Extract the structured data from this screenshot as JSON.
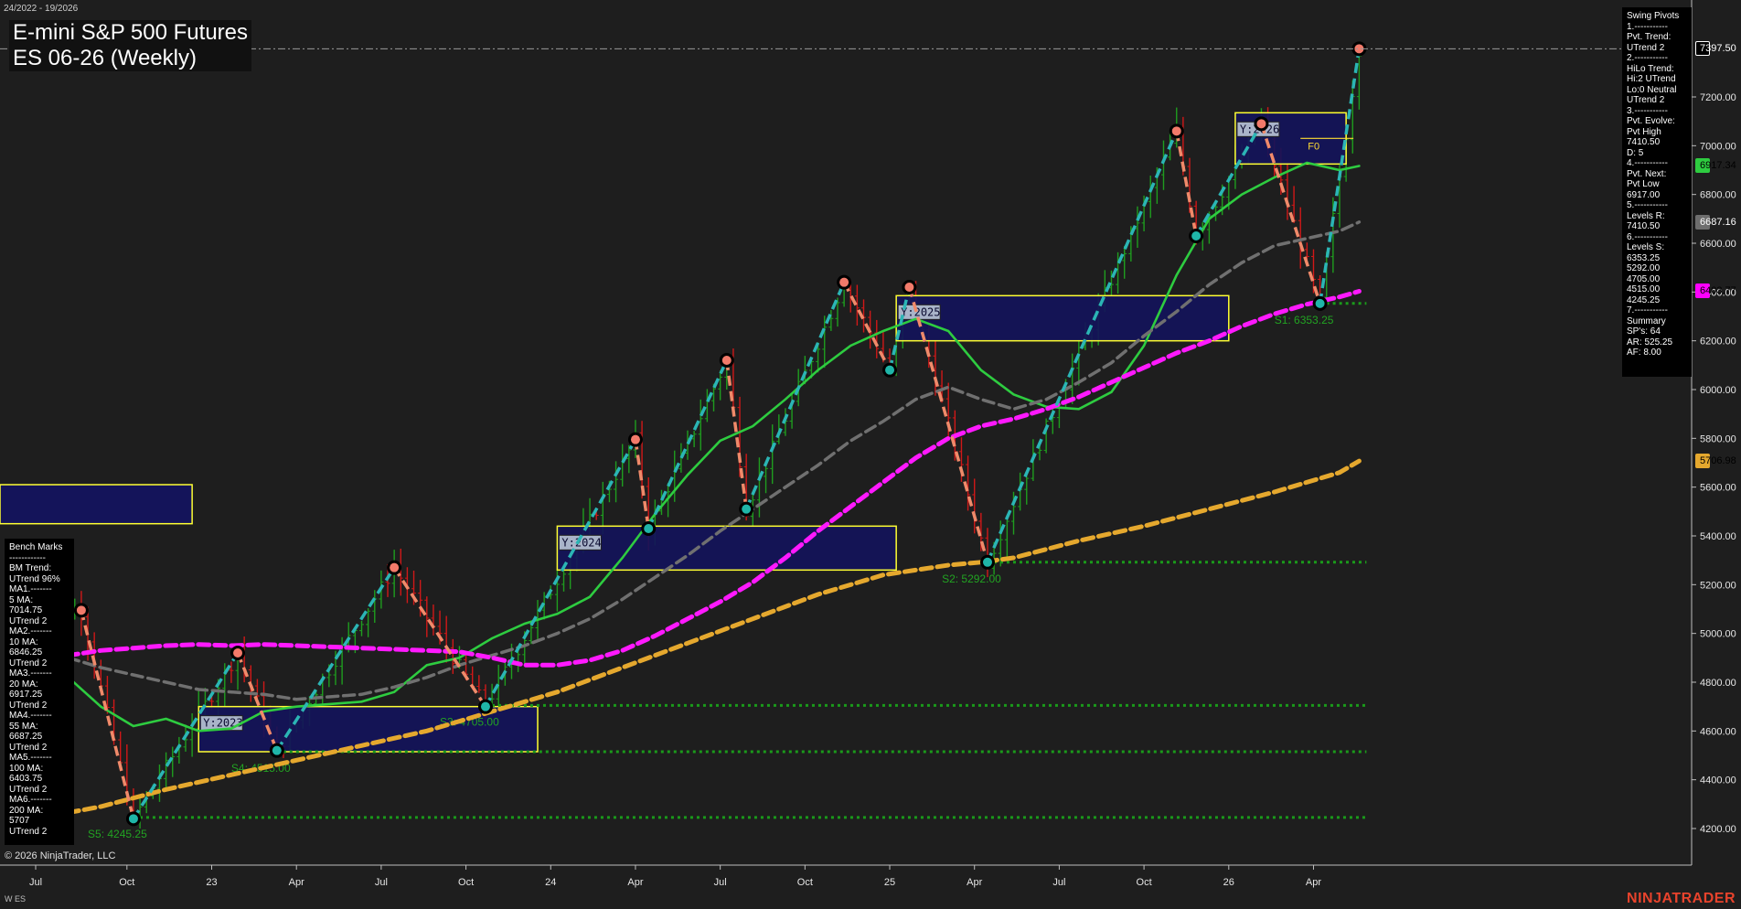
{
  "header": {
    "date_range": "24/2022 - 19/2026",
    "title_line1": "E-mini S&P 500 Futures",
    "title_line2": "ES 06-26 (Weekly)"
  },
  "footer": {
    "copyright": "© 2026 NinjaTrader, LLC",
    "series_tag": "W ES",
    "brand": "NINJATRADER"
  },
  "bench_marks": {
    "lines": [
      "Bench Marks",
      "------------",
      "BM Trend:",
      "UTrend 96%",
      "MA1.-------",
      "5 MA:",
      "7014.75",
      "UTrend 2",
      "MA2.-------",
      "10 MA:",
      "6846.25",
      "UTrend 2",
      "MA3.-------",
      "20 MA:",
      "6917.25",
      "UTrend 2",
      "MA4.-------",
      "55 MA:",
      "6687.25",
      "UTrend 2",
      "MA5.-------",
      "100 MA:",
      "6403.75",
      "UTrend 2",
      "MA6.-------",
      "200 MA:",
      "5707",
      "UTrend 2"
    ]
  },
  "swing_pivots": {
    "lines": [
      "Swing Pivots",
      "1.-----------",
      "Pvt. Trend:",
      "UTrend 2",
      "2.-----------",
      "HiLo Trend:",
      "Hi:2 UTrend",
      "Lo:0 Neutral",
      "UTrend 2",
      "3.-----------",
      "Pvt. Evolve:",
      "Pvt High",
      "7410.50",
      "D: 5",
      "4.-----------",
      "Pvt. Next:",
      "Pvt Low",
      "6917.00",
      "5.-----------",
      "Levels R:",
      "7410.50",
      "6.-----------",
      "Levels S:",
      "6353.25",
      "5292.00",
      "4705.00",
      "4515.00",
      "4245.25",
      "7.-----------",
      "Summary",
      "SP's: 64",
      "AR: 525.25",
      "AF: 8.00"
    ]
  },
  "price_tags": [
    {
      "label": "7397.50",
      "price": 7397.5,
      "bg": "#000000",
      "fg": "#ffffff",
      "border": "#ffffff"
    },
    {
      "label": "6917.34",
      "price": 6917.34,
      "bg": "#2ecc40",
      "fg": "#000000",
      "border": "#2ecc40"
    },
    {
      "label": "6687.16",
      "price": 6687.16,
      "bg": "#6e6e6e",
      "fg": "#ffffff",
      "border": "#6e6e6e"
    },
    {
      "label": "6403.77",
      "price": 6403.77,
      "bg": "#ff00ff",
      "fg": "#000000",
      "border": "#ff00ff"
    },
    {
      "label": "5706.98",
      "price": 5706.98,
      "bg": "#e5a82e",
      "fg": "#000000",
      "border": "#e5a82e"
    }
  ],
  "colors": {
    "background": "#1e1e1e",
    "ma_green": "#2ecc40",
    "ma_gray": "#707070",
    "ma_magenta": "#ff19ff",
    "ma_orange": "#e5a82e",
    "swing_up": "#2bb5b5",
    "swing_down": "#f08a6a",
    "box_fill": "#14145a",
    "box_border": "#ffff33",
    "support": "#1a9a1a",
    "bar_up": "#1f9d1f",
    "bar_down": "#d01818"
  },
  "chart_data": {
    "type": "line",
    "title": "E-mini S&P 500 Futures",
    "subtitle": "ES 06-26 (Weekly)",
    "xlabel": "",
    "ylabel": "",
    "ylim": [
      4100,
      7500
    ],
    "x_tick_labels": [
      "Jul",
      "Oct",
      "23",
      "Apr",
      "Jul",
      "Oct",
      "24",
      "Apr",
      "Jul",
      "Oct",
      "25",
      "Apr",
      "Jul",
      "Oct",
      "26",
      "Apr"
    ],
    "x_tick_weeks": [
      0,
      14,
      27,
      40,
      53,
      66,
      79,
      92,
      105,
      118,
      131,
      144,
      157,
      170,
      183,
      196
    ],
    "y_ticks": [
      4200,
      4400,
      4600,
      4800,
      5000,
      5200,
      5400,
      5600,
      5800,
      6000,
      6200,
      6400,
      6600,
      6800,
      7000,
      7200
    ],
    "grid": false,
    "legend": "none",
    "swing_pivots": [
      {
        "week": 7,
        "price": 5095,
        "kind": "high"
      },
      {
        "week": 15,
        "price": 4240,
        "kind": "low"
      },
      {
        "week": 31,
        "price": 4920,
        "kind": "high"
      },
      {
        "week": 37,
        "price": 4520,
        "kind": "low"
      },
      {
        "week": 55,
        "price": 5270,
        "kind": "high"
      },
      {
        "week": 69,
        "price": 4700,
        "kind": "low"
      },
      {
        "week": 92,
        "price": 5795,
        "kind": "high"
      },
      {
        "week": 94,
        "price": 5430,
        "kind": "low"
      },
      {
        "week": 106,
        "price": 6120,
        "kind": "high"
      },
      {
        "week": 109,
        "price": 5510,
        "kind": "low"
      },
      {
        "week": 124,
        "price": 6440,
        "kind": "high"
      },
      {
        "week": 131,
        "price": 6080,
        "kind": "low"
      },
      {
        "week": 134,
        "price": 6420,
        "kind": "high"
      },
      {
        "week": 146,
        "price": 5292,
        "kind": "low"
      },
      {
        "week": 175,
        "price": 7060,
        "kind": "high"
      },
      {
        "week": 178,
        "price": 6630,
        "kind": "low"
      },
      {
        "week": 188,
        "price": 7090,
        "kind": "high"
      },
      {
        "week": 197,
        "price": 6353,
        "kind": "low"
      },
      {
        "week": 203,
        "price": 7397.5,
        "kind": "high"
      }
    ],
    "year_boxes": [
      {
        "label": "Y:2023",
        "week_start": 25,
        "week_end": 77,
        "price_low": 4515,
        "price_high": 4700
      },
      {
        "label": "Y:2024",
        "week_start": 80,
        "week_end": 132,
        "price_low": 5260,
        "price_high": 5440
      },
      {
        "label": "Y:2025",
        "week_start": 132,
        "week_end": 183,
        "price_low": 6200,
        "price_high": 6385
      },
      {
        "label": "Y:2026",
        "week_start": 184,
        "week_end": 201,
        "price_low": 6925,
        "price_high": 7135
      }
    ],
    "prior_box": {
      "week_start": -8,
      "week_end": 24,
      "price_low": 5450,
      "price_high": 5610
    },
    "support_levels": [
      {
        "label": "S1: 6353.25",
        "price": 6353.25,
        "week_start": 197,
        "label_week": 190
      },
      {
        "label": "S2: 5292.00",
        "price": 5292,
        "week_start": 146,
        "label_week": 139
      },
      {
        "label": "S3: 4705.00",
        "price": 4705,
        "week_start": 69,
        "label_week": 62
      },
      {
        "label": "S4: 4515.00",
        "price": 4515,
        "week_start": 37,
        "label_week": 30
      },
      {
        "label": "S5: 4245.25",
        "price": 4245.25,
        "week_start": 15,
        "label_week": 8
      }
    ],
    "f0_label": "F0",
    "f0_price": 7030,
    "moving_averages": [
      {
        "id": "ma_20",
        "color_key": "ma_green",
        "dashed": false,
        "points": [
          [
            0,
            4880
          ],
          [
            5,
            4820
          ],
          [
            10,
            4700
          ],
          [
            15,
            4620
          ],
          [
            20,
            4650
          ],
          [
            25,
            4600
          ],
          [
            30,
            4610
          ],
          [
            35,
            4680
          ],
          [
            40,
            4700
          ],
          [
            50,
            4720
          ],
          [
            55,
            4760
          ],
          [
            60,
            4870
          ],
          [
            65,
            4900
          ],
          [
            70,
            4980
          ],
          [
            75,
            5040
          ],
          [
            80,
            5080
          ],
          [
            85,
            5150
          ],
          [
            90,
            5310
          ],
          [
            95,
            5490
          ],
          [
            100,
            5650
          ],
          [
            105,
            5790
          ],
          [
            110,
            5850
          ],
          [
            115,
            5960
          ],
          [
            120,
            6080
          ],
          [
            125,
            6180
          ],
          [
            130,
            6240
          ],
          [
            135,
            6290
          ],
          [
            140,
            6240
          ],
          [
            145,
            6080
          ],
          [
            150,
            5980
          ],
          [
            155,
            5930
          ],
          [
            160,
            5920
          ],
          [
            165,
            5990
          ],
          [
            170,
            6180
          ],
          [
            175,
            6470
          ],
          [
            180,
            6700
          ],
          [
            185,
            6800
          ],
          [
            190,
            6870
          ],
          [
            195,
            6930
          ],
          [
            200,
            6900
          ],
          [
            203,
            6917
          ]
        ]
      },
      {
        "id": "ma_55",
        "color_key": "ma_gray",
        "dashed": true,
        "points": [
          [
            0,
            4920
          ],
          [
            5,
            4900
          ],
          [
            10,
            4860
          ],
          [
            15,
            4830
          ],
          [
            20,
            4800
          ],
          [
            25,
            4770
          ],
          [
            30,
            4760
          ],
          [
            35,
            4750
          ],
          [
            40,
            4730
          ],
          [
            45,
            4740
          ],
          [
            50,
            4750
          ],
          [
            55,
            4780
          ],
          [
            60,
            4820
          ],
          [
            65,
            4870
          ],
          [
            70,
            4910
          ],
          [
            75,
            4950
          ],
          [
            80,
            5000
          ],
          [
            85,
            5060
          ],
          [
            90,
            5140
          ],
          [
            95,
            5230
          ],
          [
            100,
            5320
          ],
          [
            105,
            5420
          ],
          [
            110,
            5510
          ],
          [
            115,
            5600
          ],
          [
            120,
            5690
          ],
          [
            125,
            5790
          ],
          [
            130,
            5870
          ],
          [
            135,
            5960
          ],
          [
            140,
            6010
          ],
          [
            145,
            5960
          ],
          [
            150,
            5920
          ],
          [
            155,
            5960
          ],
          [
            160,
            6030
          ],
          [
            165,
            6110
          ],
          [
            170,
            6220
          ],
          [
            175,
            6320
          ],
          [
            180,
            6430
          ],
          [
            185,
            6520
          ],
          [
            190,
            6590
          ],
          [
            195,
            6620
          ],
          [
            200,
            6650
          ],
          [
            203,
            6687
          ]
        ]
      },
      {
        "id": "ma_100",
        "color_key": "ma_magenta",
        "dashed": true,
        "points": [
          [
            0,
            4870
          ],
          [
            5,
            4910
          ],
          [
            10,
            4930
          ],
          [
            15,
            4940
          ],
          [
            20,
            4950
          ],
          [
            25,
            4955
          ],
          [
            30,
            4950
          ],
          [
            35,
            4955
          ],
          [
            40,
            4950
          ],
          [
            45,
            4945
          ],
          [
            50,
            4940
          ],
          [
            55,
            4935
          ],
          [
            60,
            4930
          ],
          [
            65,
            4925
          ],
          [
            70,
            4900
          ],
          [
            75,
            4870
          ],
          [
            80,
            4870
          ],
          [
            85,
            4890
          ],
          [
            90,
            4930
          ],
          [
            95,
            4990
          ],
          [
            100,
            5060
          ],
          [
            105,
            5130
          ],
          [
            110,
            5210
          ],
          [
            115,
            5310
          ],
          [
            120,
            5420
          ],
          [
            125,
            5520
          ],
          [
            130,
            5620
          ],
          [
            135,
            5720
          ],
          [
            140,
            5800
          ],
          [
            145,
            5850
          ],
          [
            150,
            5880
          ],
          [
            155,
            5920
          ],
          [
            160,
            5970
          ],
          [
            165,
            6030
          ],
          [
            170,
            6090
          ],
          [
            175,
            6150
          ],
          [
            180,
            6200
          ],
          [
            185,
            6260
          ],
          [
            190,
            6310
          ],
          [
            195,
            6350
          ],
          [
            200,
            6380
          ],
          [
            203,
            6403
          ]
        ]
      },
      {
        "id": "ma_200",
        "color_key": "ma_orange",
        "dashed": true,
        "points": [
          [
            0,
            4240
          ],
          [
            10,
            4290
          ],
          [
            20,
            4360
          ],
          [
            30,
            4420
          ],
          [
            40,
            4480
          ],
          [
            50,
            4540
          ],
          [
            60,
            4600
          ],
          [
            70,
            4680
          ],
          [
            80,
            4760
          ],
          [
            90,
            4860
          ],
          [
            100,
            4960
          ],
          [
            110,
            5060
          ],
          [
            120,
            5160
          ],
          [
            130,
            5240
          ],
          [
            140,
            5280
          ],
          [
            145,
            5292
          ],
          [
            150,
            5310
          ],
          [
            160,
            5380
          ],
          [
            170,
            5440
          ],
          [
            180,
            5510
          ],
          [
            190,
            5580
          ],
          [
            200,
            5660
          ],
          [
            203,
            5707
          ]
        ]
      }
    ]
  }
}
